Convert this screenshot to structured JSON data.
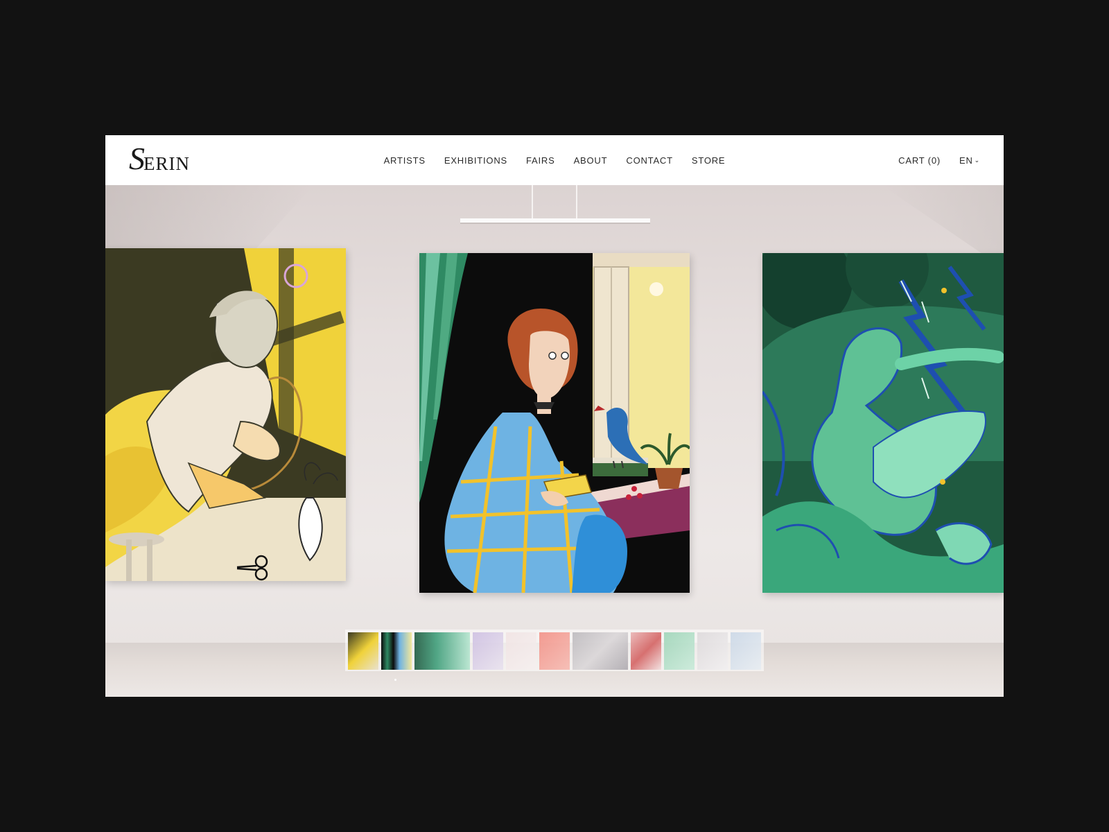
{
  "brand": {
    "logo_initial": "S",
    "logo_rest": "ERIN"
  },
  "nav": {
    "items": [
      "ARTISTS",
      "EXHIBITIONS",
      "FAIRS",
      "ABOUT",
      "CONTACT",
      "STORE"
    ]
  },
  "header_right": {
    "cart_label": "CART (0)",
    "language": "EN"
  },
  "gallery": {
    "artworks": [
      {
        "name": "figure-with-scissors-painting",
        "palette": [
          "#f0d23a",
          "#3b3a22",
          "#f4e6c4"
        ]
      },
      {
        "name": "woman-reading-with-bird-painting",
        "palette": [
          "#5aa3d7",
          "#0d0d0d",
          "#f3e79a"
        ]
      },
      {
        "name": "green-storm-figures-painting",
        "palette": [
          "#3f9e7a",
          "#1f5a40",
          "#7ed3b0"
        ]
      }
    ],
    "thumbnails_count": 13,
    "active_thumbnail": 1
  },
  "colors": {
    "background": "#121212",
    "header": "#ffffff",
    "wall": "#ebe4e3",
    "text": "#2a2a2a"
  },
  "icons": [
    "chevron-down-icon"
  ]
}
